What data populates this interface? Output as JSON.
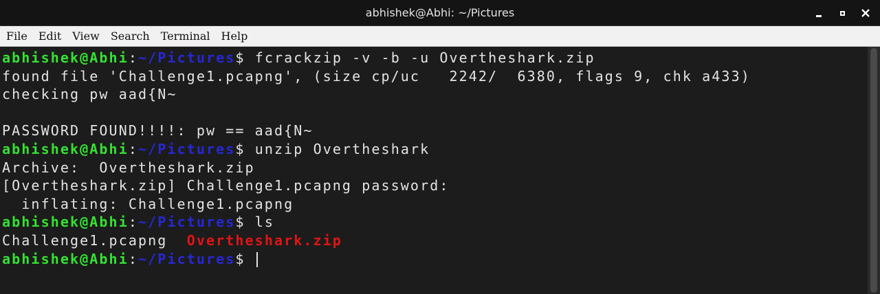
{
  "window": {
    "title": "abhishek@Abhi: ~/Pictures",
    "controls": [
      "minimize-icon",
      "maximize-icon",
      "close-icon"
    ]
  },
  "menu": {
    "items": [
      {
        "label": "File"
      },
      {
        "label": "Edit"
      },
      {
        "label": "View"
      },
      {
        "label": "Search"
      },
      {
        "label": "Terminal"
      },
      {
        "label": "Help"
      }
    ]
  },
  "prompt": {
    "user": "abhishek@Abhi",
    "sep": ":",
    "path": "~/Pictures",
    "symbol": "$"
  },
  "terminal": {
    "cmd1": " fcrackzip -v -b -u Overtheshark.zip",
    "out1": "found file 'Challenge1.pcapng', (size cp/uc   2242/  6380, flags 9, chk a433)",
    "out2": "checking pw aad{N~",
    "out3": "",
    "out4": "PASSWORD FOUND!!!!: pw == aad{N~",
    "cmd2": " unzip Overtheshark",
    "out5": "Archive:  Overtheshark.zip",
    "out6": "[Overtheshark.zip] Challenge1.pcapng password:",
    "out7": "  inflating: Challenge1.pcapng",
    "cmd3": " ls",
    "ls_file1": "Challenge1.pcapng  ",
    "ls_file2": "Overtheshark.zip",
    "cmd4": " "
  },
  "colors": {
    "user": "#35e232",
    "path": "#2727d6",
    "archive": "#e21414",
    "background": "#1c1c1c",
    "text": "#e4e4e4"
  }
}
